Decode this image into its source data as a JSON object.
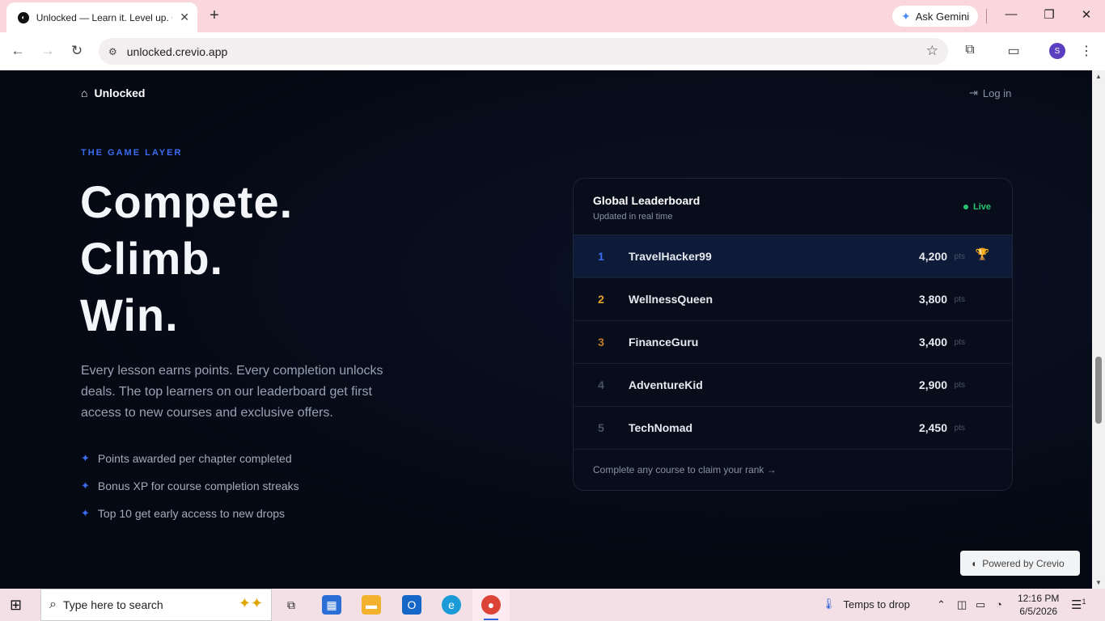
{
  "browser": {
    "tab_title": "Unlocked — Learn it. Level up. Get it.",
    "tab_close": "✕",
    "new_tab": "+",
    "ask_gemini": "Ask Gemini",
    "url": "unlocked.crevio.app",
    "profile_initial": "S",
    "window_controls": {
      "minimize": "—",
      "restore": "❐",
      "close": "✕"
    }
  },
  "page": {
    "brand": "Unlocked",
    "login": "Log in",
    "eyebrow": "THE GAME LAYER",
    "headline": [
      "Compete.",
      "Climb.",
      "Win."
    ],
    "description": "Every lesson earns points. Every completion unlocks deals. The top learners on our leaderboard get first access to new courses and exclusive offers.",
    "features": [
      "Points awarded per chapter completed",
      "Bonus XP for course completion streaks",
      "Top 10 get early access to new drops"
    ],
    "leaderboard": {
      "title": "Global Leaderboard",
      "subtitle": "Updated in real time",
      "live": "Live",
      "unit": "pts",
      "footer": "Complete any course to claim your rank →",
      "rows": [
        {
          "rank": "1",
          "name": "TravelHacker99",
          "points": "4,200",
          "rank_color": "#3b6cf0"
        },
        {
          "rank": "2",
          "name": "WellnessQueen",
          "points": "3,800",
          "rank_color": "#e8a12c"
        },
        {
          "rank": "3",
          "name": "FinanceGuru",
          "points": "3,400",
          "rank_color": "#c47a2c"
        },
        {
          "rank": "4",
          "name": "AdventureKid",
          "points": "2,900",
          "rank_color": "#4a5366"
        },
        {
          "rank": "5",
          "name": "TechNomad",
          "points": "2,450",
          "rank_color": "#4a5366"
        }
      ]
    },
    "powered_by": "Powered by Crevio"
  },
  "taskbar": {
    "search_placeholder": "Type here to search",
    "weather": "Temps to drop",
    "time": "12:16 PM",
    "date": "6/5/2026",
    "notification_count": "1"
  },
  "icons": {
    "accent": "#3b6cf0",
    "live": "#28c76f",
    "trophy": "#f5b400"
  }
}
